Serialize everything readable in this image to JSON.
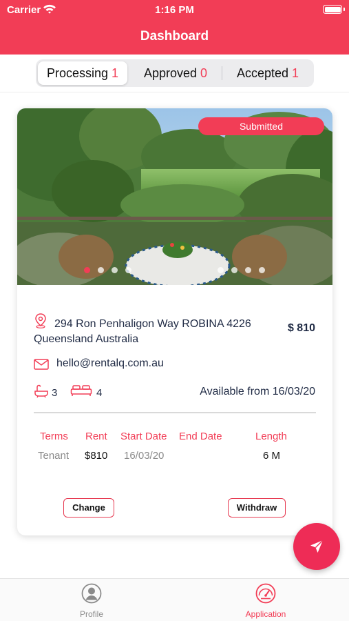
{
  "status_bar": {
    "carrier": "Carrier",
    "time": "1:16 PM"
  },
  "header": {
    "title": "Dashboard"
  },
  "segments": [
    {
      "label": "Processing",
      "count": "1",
      "active": true
    },
    {
      "label": "Approved",
      "count": "0",
      "active": false
    },
    {
      "label": "Accepted",
      "count": "1",
      "active": false
    }
  ],
  "card": {
    "status_badge": "Submitted",
    "carousel": {
      "total_dots": 8,
      "active_index": 0
    },
    "address": "294 Ron Penhaligon Way ROBINA 4226 Queensland Australia",
    "price": "$ 810",
    "email": "hello@rentalq.com.au",
    "bathrooms": "3",
    "bedrooms": "4",
    "available": "Available from 16/03/20",
    "table": {
      "headers": [
        "Terms",
        "Rent",
        "Start Date",
        "End Date",
        "Length"
      ],
      "row": [
        "Tenant",
        "$810",
        "16/03/20",
        "",
        "6 M"
      ]
    },
    "buttons": {
      "change": "Change",
      "withdraw": "Withdraw"
    }
  },
  "fab": {
    "icon": "send-icon"
  },
  "tabbar": {
    "items": [
      {
        "label": "Profile",
        "icon": "profile-icon",
        "active": false
      },
      {
        "label": "Application",
        "icon": "speedometer-icon",
        "active": true
      }
    ]
  },
  "colors": {
    "accent": "#f23d56",
    "text_dark": "#1f2a44",
    "muted": "#8a8a8a"
  }
}
